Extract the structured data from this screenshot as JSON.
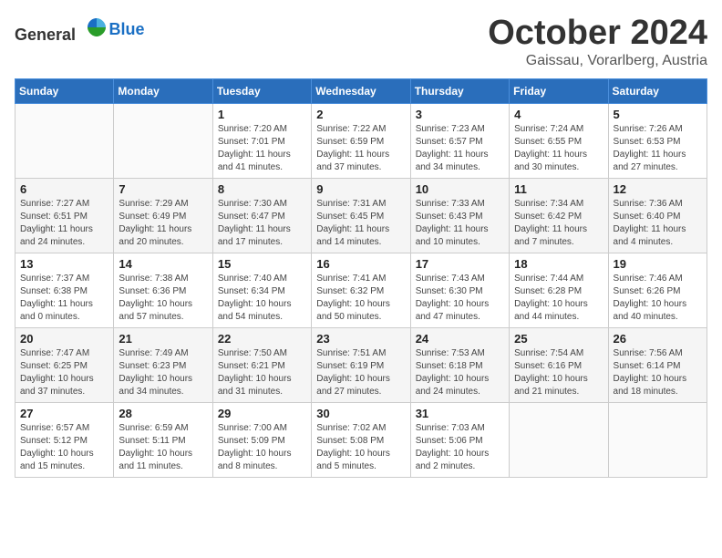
{
  "header": {
    "logo_general": "General",
    "logo_blue": "Blue",
    "month": "October 2024",
    "location": "Gaissau, Vorarlberg, Austria"
  },
  "days_of_week": [
    "Sunday",
    "Monday",
    "Tuesday",
    "Wednesday",
    "Thursday",
    "Friday",
    "Saturday"
  ],
  "weeks": [
    [
      {
        "day": "",
        "content": ""
      },
      {
        "day": "",
        "content": ""
      },
      {
        "day": "1",
        "content": "Sunrise: 7:20 AM\nSunset: 7:01 PM\nDaylight: 11 hours\nand 41 minutes."
      },
      {
        "day": "2",
        "content": "Sunrise: 7:22 AM\nSunset: 6:59 PM\nDaylight: 11 hours\nand 37 minutes."
      },
      {
        "day": "3",
        "content": "Sunrise: 7:23 AM\nSunset: 6:57 PM\nDaylight: 11 hours\nand 34 minutes."
      },
      {
        "day": "4",
        "content": "Sunrise: 7:24 AM\nSunset: 6:55 PM\nDaylight: 11 hours\nand 30 minutes."
      },
      {
        "day": "5",
        "content": "Sunrise: 7:26 AM\nSunset: 6:53 PM\nDaylight: 11 hours\nand 27 minutes."
      }
    ],
    [
      {
        "day": "6",
        "content": "Sunrise: 7:27 AM\nSunset: 6:51 PM\nDaylight: 11 hours\nand 24 minutes."
      },
      {
        "day": "7",
        "content": "Sunrise: 7:29 AM\nSunset: 6:49 PM\nDaylight: 11 hours\nand 20 minutes."
      },
      {
        "day": "8",
        "content": "Sunrise: 7:30 AM\nSunset: 6:47 PM\nDaylight: 11 hours\nand 17 minutes."
      },
      {
        "day": "9",
        "content": "Sunrise: 7:31 AM\nSunset: 6:45 PM\nDaylight: 11 hours\nand 14 minutes."
      },
      {
        "day": "10",
        "content": "Sunrise: 7:33 AM\nSunset: 6:43 PM\nDaylight: 11 hours\nand 10 minutes."
      },
      {
        "day": "11",
        "content": "Sunrise: 7:34 AM\nSunset: 6:42 PM\nDaylight: 11 hours\nand 7 minutes."
      },
      {
        "day": "12",
        "content": "Sunrise: 7:36 AM\nSunset: 6:40 PM\nDaylight: 11 hours\nand 4 minutes."
      }
    ],
    [
      {
        "day": "13",
        "content": "Sunrise: 7:37 AM\nSunset: 6:38 PM\nDaylight: 11 hours\nand 0 minutes."
      },
      {
        "day": "14",
        "content": "Sunrise: 7:38 AM\nSunset: 6:36 PM\nDaylight: 10 hours\nand 57 minutes."
      },
      {
        "day": "15",
        "content": "Sunrise: 7:40 AM\nSunset: 6:34 PM\nDaylight: 10 hours\nand 54 minutes."
      },
      {
        "day": "16",
        "content": "Sunrise: 7:41 AM\nSunset: 6:32 PM\nDaylight: 10 hours\nand 50 minutes."
      },
      {
        "day": "17",
        "content": "Sunrise: 7:43 AM\nSunset: 6:30 PM\nDaylight: 10 hours\nand 47 minutes."
      },
      {
        "day": "18",
        "content": "Sunrise: 7:44 AM\nSunset: 6:28 PM\nDaylight: 10 hours\nand 44 minutes."
      },
      {
        "day": "19",
        "content": "Sunrise: 7:46 AM\nSunset: 6:26 PM\nDaylight: 10 hours\nand 40 minutes."
      }
    ],
    [
      {
        "day": "20",
        "content": "Sunrise: 7:47 AM\nSunset: 6:25 PM\nDaylight: 10 hours\nand 37 minutes."
      },
      {
        "day": "21",
        "content": "Sunrise: 7:49 AM\nSunset: 6:23 PM\nDaylight: 10 hours\nand 34 minutes."
      },
      {
        "day": "22",
        "content": "Sunrise: 7:50 AM\nSunset: 6:21 PM\nDaylight: 10 hours\nand 31 minutes."
      },
      {
        "day": "23",
        "content": "Sunrise: 7:51 AM\nSunset: 6:19 PM\nDaylight: 10 hours\nand 27 minutes."
      },
      {
        "day": "24",
        "content": "Sunrise: 7:53 AM\nSunset: 6:18 PM\nDaylight: 10 hours\nand 24 minutes."
      },
      {
        "day": "25",
        "content": "Sunrise: 7:54 AM\nSunset: 6:16 PM\nDaylight: 10 hours\nand 21 minutes."
      },
      {
        "day": "26",
        "content": "Sunrise: 7:56 AM\nSunset: 6:14 PM\nDaylight: 10 hours\nand 18 minutes."
      }
    ],
    [
      {
        "day": "27",
        "content": "Sunrise: 6:57 AM\nSunset: 5:12 PM\nDaylight: 10 hours\nand 15 minutes."
      },
      {
        "day": "28",
        "content": "Sunrise: 6:59 AM\nSunset: 5:11 PM\nDaylight: 10 hours\nand 11 minutes."
      },
      {
        "day": "29",
        "content": "Sunrise: 7:00 AM\nSunset: 5:09 PM\nDaylight: 10 hours\nand 8 minutes."
      },
      {
        "day": "30",
        "content": "Sunrise: 7:02 AM\nSunset: 5:08 PM\nDaylight: 10 hours\nand 5 minutes."
      },
      {
        "day": "31",
        "content": "Sunrise: 7:03 AM\nSunset: 5:06 PM\nDaylight: 10 hours\nand 2 minutes."
      },
      {
        "day": "",
        "content": ""
      },
      {
        "day": "",
        "content": ""
      }
    ]
  ]
}
